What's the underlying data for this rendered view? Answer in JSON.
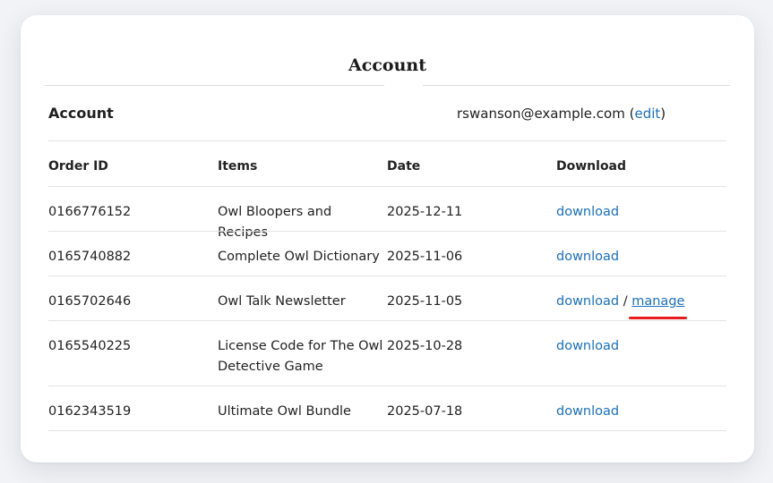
{
  "page": {
    "title": "Account"
  },
  "account": {
    "label": "Account",
    "email": "rswanson@example.com",
    "edit_label": "edit",
    "paren_open": "(",
    "paren_close": ")"
  },
  "orders": {
    "headers": {
      "order_id": "Order ID",
      "items": "Items",
      "date": "Date",
      "download": "Download"
    },
    "separator": "/",
    "rows": [
      {
        "order_id": "0166776152",
        "item": "Owl Bloopers and Recipes",
        "date": "2025-12-11",
        "download_label": "download"
      },
      {
        "order_id": "0165740882",
        "item": "Complete Owl Dictionary",
        "date": "2025-11-06",
        "download_label": "download"
      },
      {
        "order_id": "0165702646",
        "item": "Owl Talk Newsletter",
        "date": "2025-11-05",
        "download_label": "download",
        "manage_label": "manage"
      },
      {
        "order_id": "0165540225",
        "item": "License Code for The Owl Detective Game",
        "date": "2025-10-28",
        "download_label": "download"
      },
      {
        "order_id": "0162343519",
        "item": "Ultimate Owl Bundle",
        "date": "2025-07-18",
        "download_label": "download"
      }
    ]
  },
  "colors": {
    "link": "#1a6fbf",
    "highlight_underline": "#e81c1c",
    "divider": "#e3e3e3"
  }
}
